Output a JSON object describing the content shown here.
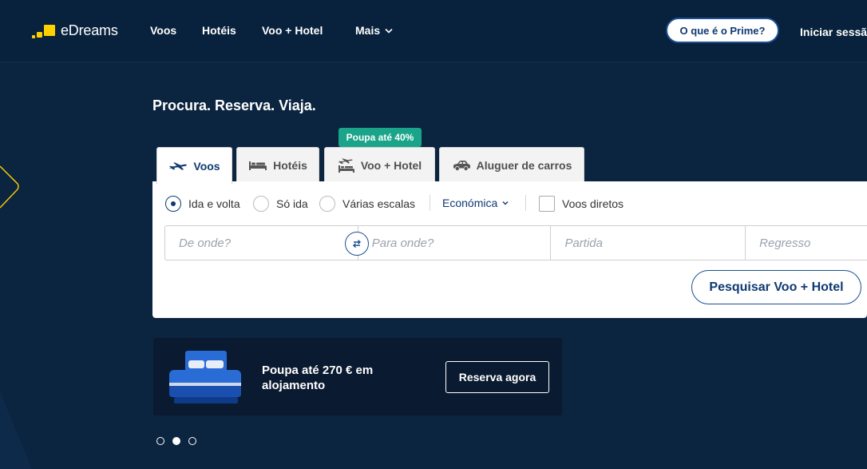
{
  "brand": {
    "name": "eDreams",
    "logo_color": "#ffd100"
  },
  "nav": {
    "items": [
      {
        "label": "Voos"
      },
      {
        "label": "Hotéis"
      },
      {
        "label": "Voo + Hotel"
      },
      {
        "label": "Mais"
      }
    ],
    "more_icon": "chevron-down-icon"
  },
  "header": {
    "prime_label": "O que é o Prime?",
    "login_label": "Iniciar sessão",
    "login_icon": "user-icon"
  },
  "hero": {
    "tagline": "Procura. Reserva. Viaja."
  },
  "promo_badge": {
    "label": "Poupa até 40%",
    "color": "#1aa48a"
  },
  "tabs": [
    {
      "label": "Voos",
      "icon": "plane-icon",
      "active": true
    },
    {
      "label": "Hotéis",
      "icon": "bed-icon",
      "active": false
    },
    {
      "label": "Voo + Hotel",
      "icon": "plane-hotel-icon",
      "active": false
    },
    {
      "label": "Aluguer de carros",
      "icon": "car-icon",
      "active": false
    }
  ],
  "search": {
    "trip_types": [
      {
        "label": "Ida e volta",
        "selected": true
      },
      {
        "label": "Só ida",
        "selected": false
      },
      {
        "label": "Várias escalas",
        "selected": false
      }
    ],
    "cabin_class": "Económica",
    "direct_label": "Voos diretos",
    "direct_checked": false,
    "fields": {
      "from_placeholder": "De onde?",
      "to_placeholder": "Para onde?",
      "depart_placeholder": "Partida",
      "return_placeholder": "Regresso"
    },
    "submit_label": "Pesquisar Voo + Hotel"
  },
  "promo": {
    "text": "Poupa até 270 € em alojamento",
    "cta_label": "Reserva agora",
    "image_icon": "bed-illustration-icon"
  },
  "carousel": {
    "count": 3,
    "active": 1
  },
  "colors": {
    "accent": "#0f3a73",
    "background": "#0b2440"
  }
}
